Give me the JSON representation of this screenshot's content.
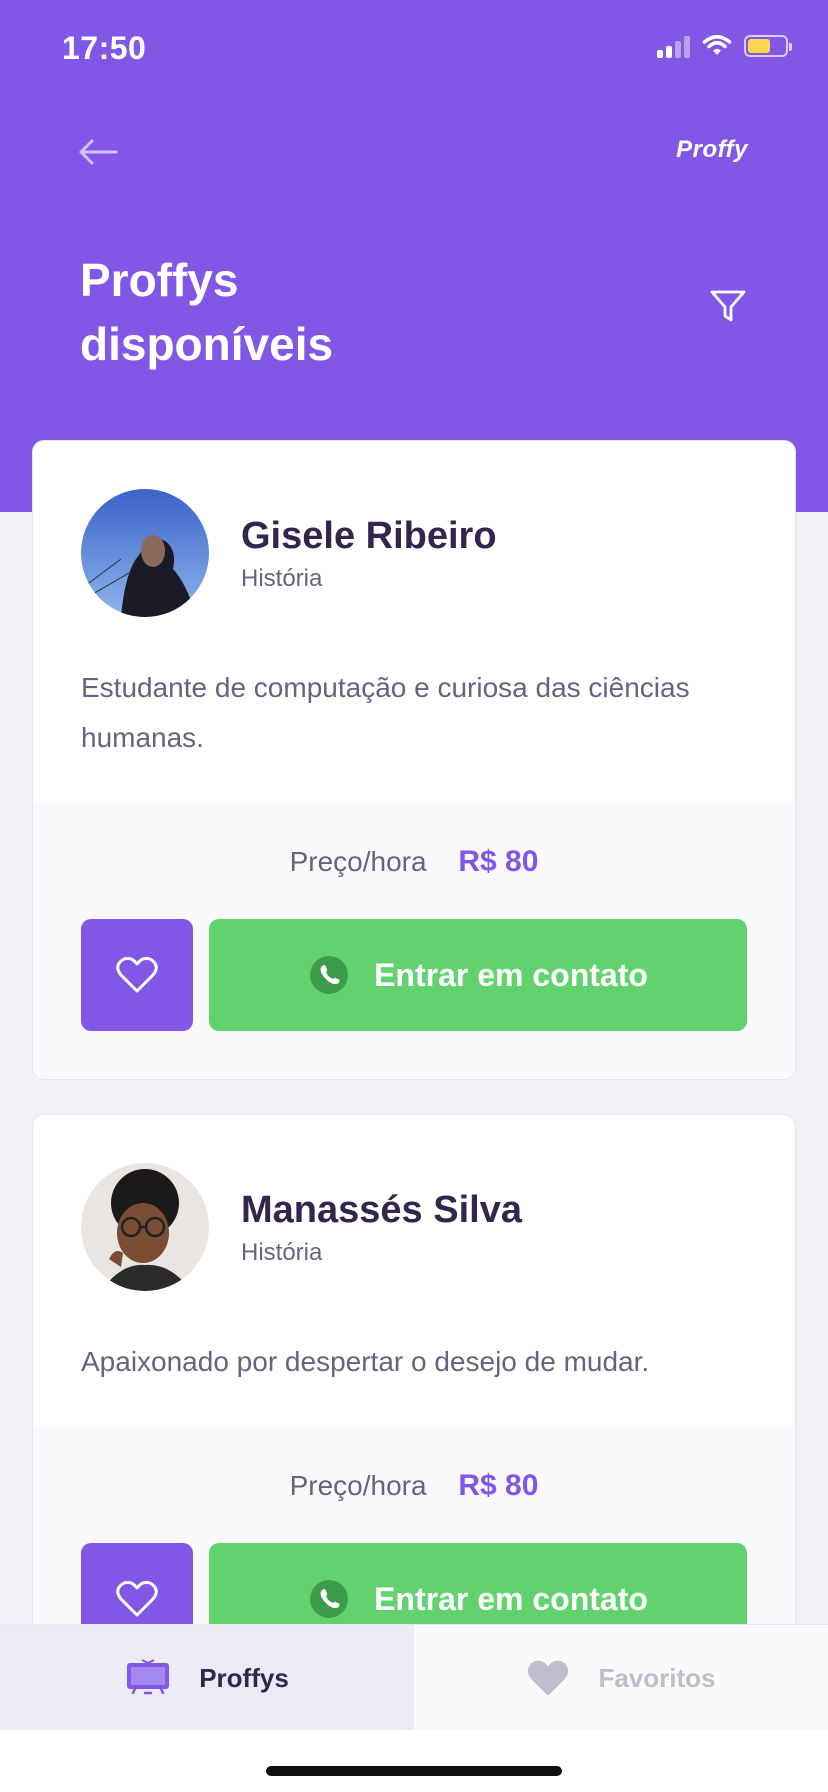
{
  "status_bar": {
    "time": "17:50"
  },
  "header": {
    "logo": "Proffy",
    "title_line1": "Proffys",
    "title_line2": "disponíveis"
  },
  "teachers": [
    {
      "name": "Gisele Ribeiro",
      "subject": "História",
      "bio": "Estudante de computação e curiosa das ciências humanas.",
      "price_label": "Preço/hora",
      "price": "R$ 80",
      "contact_label": "Entrar em contato"
    },
    {
      "name": "Manassés Silva",
      "subject": "História",
      "bio": "Apaixonado por despertar o desejo de mudar.",
      "price_label": "Preço/hora",
      "price": "R$ 80",
      "contact_label": "Entrar em contato"
    }
  ],
  "tabs": [
    {
      "label": "Proffys",
      "icon": "tv-icon",
      "active": true
    },
    {
      "label": "Favoritos",
      "icon": "heart-icon",
      "active": false
    }
  ],
  "colors": {
    "primary": "#8257E5",
    "green": "#62D26F",
    "background": "#F0F0F7",
    "title_text": "#32264D",
    "body_text": "#6A6180"
  }
}
